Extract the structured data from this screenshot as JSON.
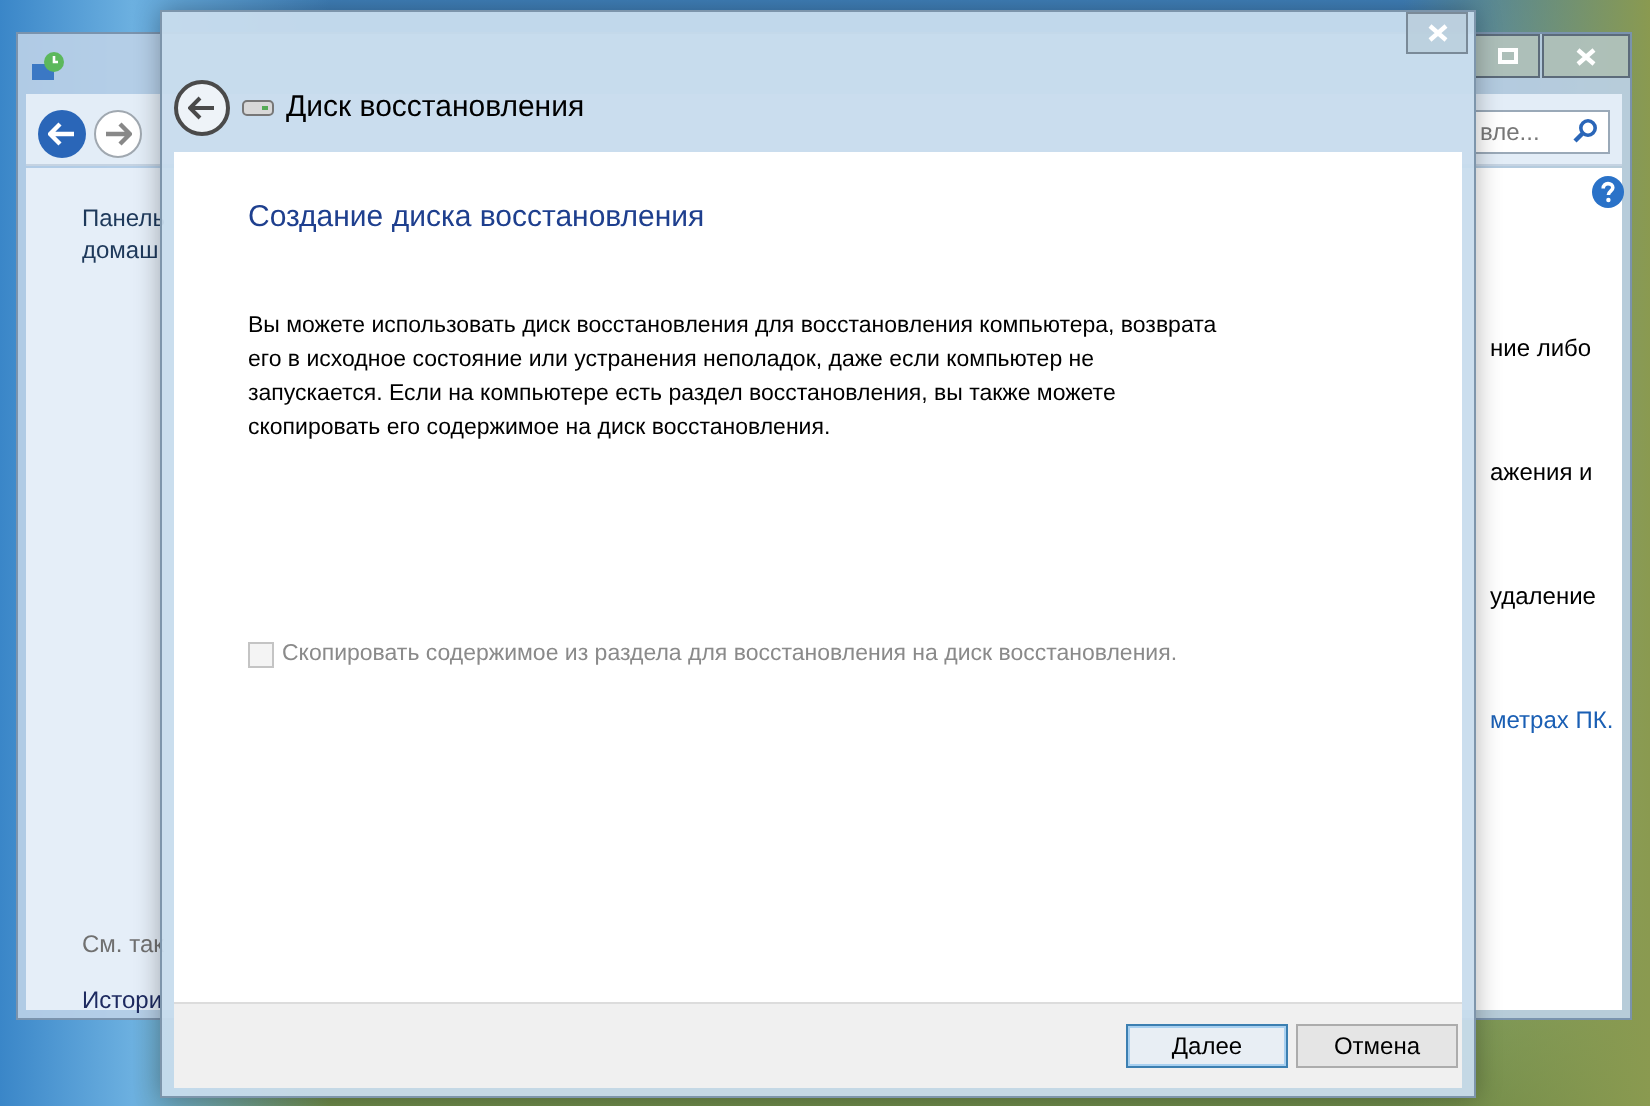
{
  "back_window": {
    "search": {
      "placeholder": "вле..."
    },
    "sidebar": {
      "items": [
        "Панель",
        "домаш"
      ],
      "see_also_heading": "См. так",
      "see_also_items": [
        "Истори"
      ]
    },
    "right_texts": [
      {
        "text": "ние либо",
        "kind": "plain"
      },
      {
        "text": "ажения и",
        "kind": "plain"
      },
      {
        "text": "удаление",
        "kind": "plain"
      },
      {
        "text": "метрах ПК.",
        "kind": "link"
      }
    ]
  },
  "dialog": {
    "title": "Диск восстановления",
    "heading": "Создание диска восстановления",
    "description": "Вы можете использовать диск восстановления для восстановления компьютера, возврата его в исходное состояние или устранения неполадок, даже если компьютер не запускается. Если на компьютере есть раздел восстановления, вы также можете скопировать его содержимое на диск восстановления.",
    "checkbox": {
      "label": "Скопировать содержимое из раздела для восстановления на диск восстановления.",
      "checked": false,
      "disabled": true
    },
    "buttons": [
      {
        "label": "Далее",
        "selected": true
      },
      {
        "label": "Отмена",
        "selected": false
      }
    ]
  }
}
